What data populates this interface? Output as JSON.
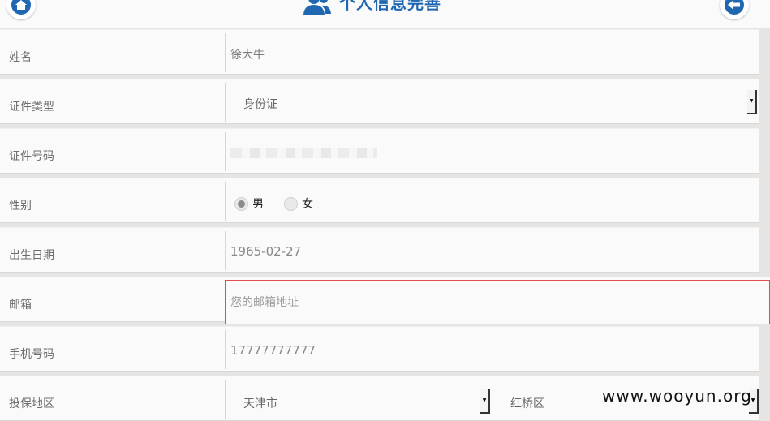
{
  "header": {
    "title": "个人信息完善",
    "home_icon": "home-icon",
    "back_icon": "back-arrow-icon",
    "title_icon": "users-icon"
  },
  "form": {
    "name": {
      "label": "姓名",
      "value": "徐大牛"
    },
    "id_type": {
      "label": "证件类型",
      "value": "身份证"
    },
    "id_number": {
      "label": "证件号码"
    },
    "gender": {
      "label": "性别",
      "options": [
        "男",
        "女"
      ],
      "selected": "男"
    },
    "birthdate": {
      "label": "出生日期",
      "value": "1965-02-27"
    },
    "email": {
      "label": "邮箱",
      "placeholder": "您的邮箱地址"
    },
    "mobile": {
      "label": "手机号码",
      "value": "17777777777"
    },
    "region": {
      "label": "投保地区",
      "city": "天津市",
      "district": "红桥区"
    }
  },
  "watermark": "www.wooyun.org",
  "colors": {
    "accent": "#1f67b1",
    "error_border": "#e34d4d",
    "background": "#e6e5e3"
  }
}
